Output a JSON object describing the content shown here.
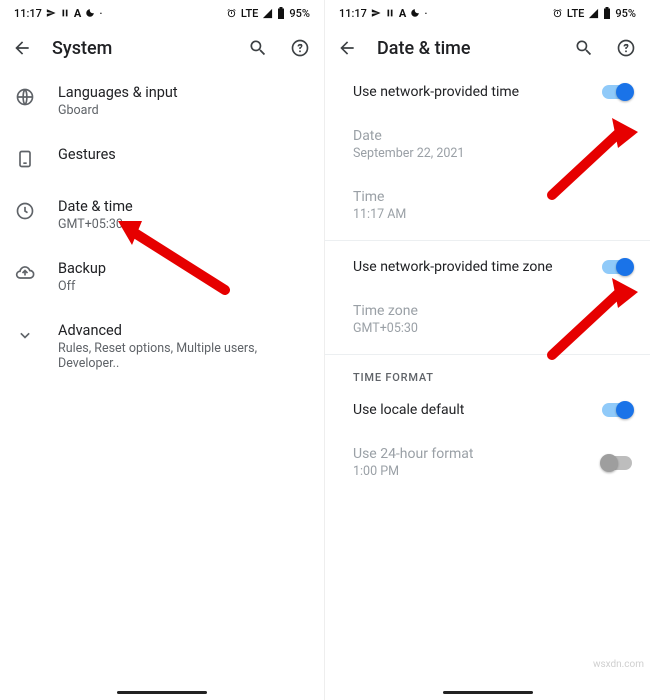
{
  "statusBar": {
    "time": "11:17",
    "network": "LTE",
    "battery": "95%"
  },
  "left": {
    "title": "System",
    "items": [
      {
        "label": "Languages & input",
        "sub": "Gboard"
      },
      {
        "label": "Gestures",
        "sub": ""
      },
      {
        "label": "Date & time",
        "sub": "GMT+05:30"
      },
      {
        "label": "Backup",
        "sub": "Off"
      },
      {
        "label": "Advanced",
        "sub": "Rules, Reset options, Multiple users, Developer.."
      }
    ]
  },
  "right": {
    "title": "Date & time",
    "rows": {
      "netTime": {
        "label": "Use network-provided time"
      },
      "date": {
        "label": "Date",
        "value": "September 22, 2021"
      },
      "time": {
        "label": "Time",
        "value": "11:17 AM"
      },
      "netZone": {
        "label": "Use network-provided time zone"
      },
      "zone": {
        "label": "Time zone",
        "value": "GMT+05:30"
      },
      "section": "TIME FORMAT",
      "locale": {
        "label": "Use locale default"
      },
      "h24": {
        "label": "Use 24-hour format",
        "value": "1:00 PM"
      }
    }
  },
  "watermark": "wsxdn.com"
}
